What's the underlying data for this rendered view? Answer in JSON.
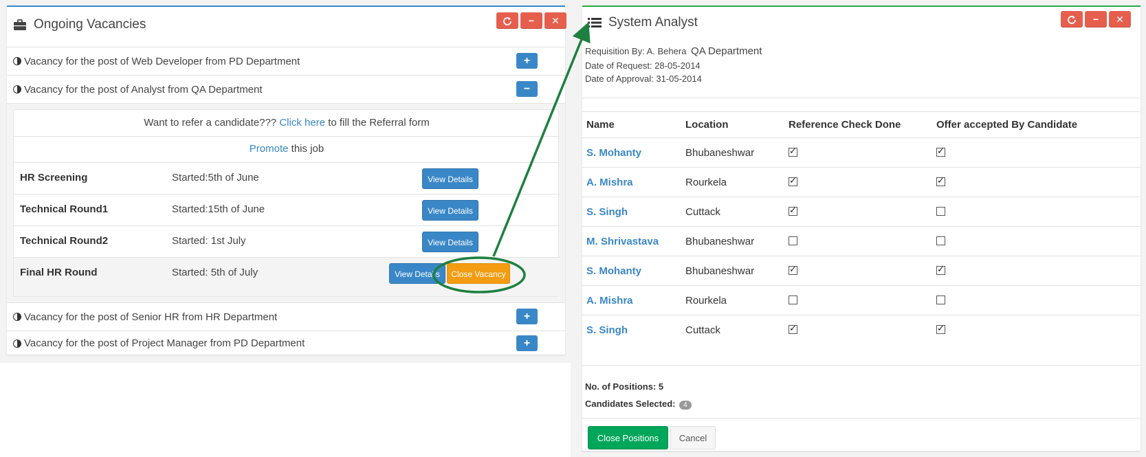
{
  "colors": {
    "accent_blue": "#3a87c7",
    "accent_green": "#00a65a",
    "danger": "#e65f4e",
    "warning": "#f39c12"
  },
  "left": {
    "title": "Ongoing Vacancies",
    "icon": "briefcase-icon",
    "controls": [
      "refresh-icon",
      "minimize-icon",
      "close-icon"
    ],
    "vacancies": [
      {
        "label": "Vacancy for the post of Web Developer from PD Department",
        "toggle": "+"
      },
      {
        "label": "Vacancy for the post of Analyst from QA Department",
        "toggle": "−"
      },
      {
        "label": "Vacancy for the post of Senior HR from HR Department",
        "toggle": "+"
      },
      {
        "label": "Vacancy for the post of Project Manager from PD Department",
        "toggle": "+"
      }
    ],
    "refer": {
      "prefix": "Want to refer a candidate???",
      "link": "Click here",
      "suffix": "to fill the Referral form"
    },
    "promote": {
      "link": "Promote",
      "suffix": "this job"
    },
    "stages": [
      {
        "name": "HR Screening",
        "started": "Started:5th of June",
        "button": "View Details"
      },
      {
        "name": "Technical Round1",
        "started": "Started:15th of June",
        "button": "View Details"
      },
      {
        "name": "Technical Round2",
        "started": "Started: 1st July",
        "button": "View Details"
      },
      {
        "name": "Final HR Round",
        "started": "Started: 5th of July",
        "button": "View Details",
        "extra_button": "Close Vacancy"
      }
    ]
  },
  "right": {
    "title": "System Analyst",
    "icon": "list-icon",
    "controls": [
      "refresh-icon",
      "minimize-icon",
      "close-icon"
    ],
    "requisition_by": "Requisition By: A. Behera",
    "department": "QA Department",
    "date_of_request": "Date of Request: 28-05-2014",
    "date_of_approval": "Date of Approval: 31-05-2014",
    "columns": [
      "Name",
      "Location",
      "Reference Check Done",
      "Offer accepted By Candidate"
    ],
    "rows": [
      {
        "name": "S. Mohanty",
        "location": "Bhubaneshwar",
        "ref": true,
        "offer": true
      },
      {
        "name": "A. Mishra",
        "location": "Rourkela",
        "ref": true,
        "offer": true
      },
      {
        "name": "S. Singh",
        "location": "Cuttack",
        "ref": true,
        "offer": false
      },
      {
        "name": "M. Shrivastava",
        "location": "Bhubaneshwar",
        "ref": false,
        "offer": false
      },
      {
        "name": "S. Mohanty",
        "location": "Bhubaneshwar",
        "ref": true,
        "offer": true
      },
      {
        "name": "A. Mishra",
        "location": "Rourkela",
        "ref": false,
        "offer": false
      },
      {
        "name": "S. Singh",
        "location": "Cuttack",
        "ref": true,
        "offer": true
      }
    ],
    "positions_label": "No. of Positions: 5",
    "selected_label": "Candidates Selected:",
    "selected_count": "4",
    "close_button": "Close Positions",
    "cancel_button": "Cancel"
  }
}
